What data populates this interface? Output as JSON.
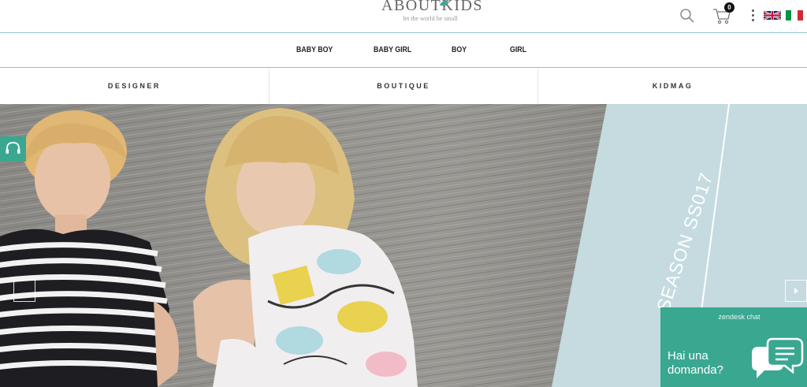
{
  "header": {
    "logo_text": "ABOUTKIDS",
    "logo_tagline": "let the world be small",
    "cart_count": "0",
    "icons": [
      "search-icon",
      "cart-icon",
      "more-vertical-icon",
      "flag-uk-icon",
      "flag-it-icon"
    ]
  },
  "category_nav": [
    {
      "label": "BABY BOY"
    },
    {
      "label": "BABY GIRL"
    },
    {
      "label": "BOY"
    },
    {
      "label": "GIRL"
    }
  ],
  "section_nav": [
    {
      "label": "DESIGNER"
    },
    {
      "label": "BOUTIQUE"
    },
    {
      "label": "KIDMAG"
    }
  ],
  "hero": {
    "season_text": "SEASON SS017"
  },
  "chat_widget": {
    "title": "zendesk chat",
    "question": "Hai una domanda?"
  },
  "colors": {
    "accent": "#3aa791",
    "divider": "#8fc6c2",
    "hero_panel": "#c5dbdf"
  }
}
